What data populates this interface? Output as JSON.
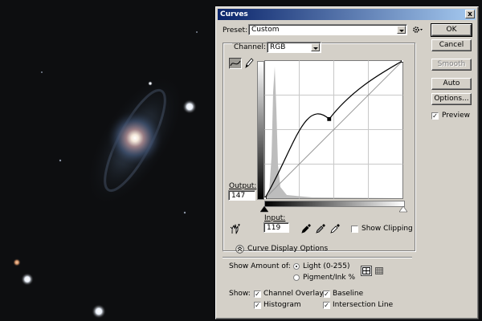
{
  "window": {
    "title": "Curves",
    "close_label": "x"
  },
  "preset": {
    "label": "Preset:",
    "value": "Custom"
  },
  "channel": {
    "label": "Channel:",
    "value": "RGB"
  },
  "buttons": {
    "ok": "OK",
    "cancel": "Cancel",
    "smooth": "Smooth",
    "auto": "Auto",
    "options": "Options..."
  },
  "preview": {
    "label": "Preview",
    "checked": true
  },
  "output": {
    "label": "Output:",
    "value": "147"
  },
  "input": {
    "label": "Input:",
    "value": "119"
  },
  "show_clipping": {
    "label": "Show Clipping",
    "checked": false
  },
  "curve_display_options": {
    "label": "Curve Display Options"
  },
  "show_amount": {
    "label": "Show Amount of:",
    "options": [
      "Light  (0-255)",
      "Pigment/Ink %"
    ],
    "selected": "Light  (0-255)"
  },
  "show": {
    "label": "Show:",
    "channel_overlays": "Channel Overlays",
    "baseline": "Baseline",
    "histogram": "Histogram",
    "intersection_line": "Intersection Line"
  },
  "curve": {
    "points": [
      [
        0,
        0
      ],
      [
        119,
        147
      ],
      [
        255,
        255
      ]
    ]
  },
  "icons": {
    "gear": "gear-icon",
    "curve_tool": "curve-tool-icon",
    "pencil": "pencil-icon",
    "hand": "targeted-adjustment-icon",
    "eyedroppers": [
      "black-eyedropper-icon",
      "gray-eyedropper-icon",
      "white-eyedropper-icon"
    ]
  }
}
